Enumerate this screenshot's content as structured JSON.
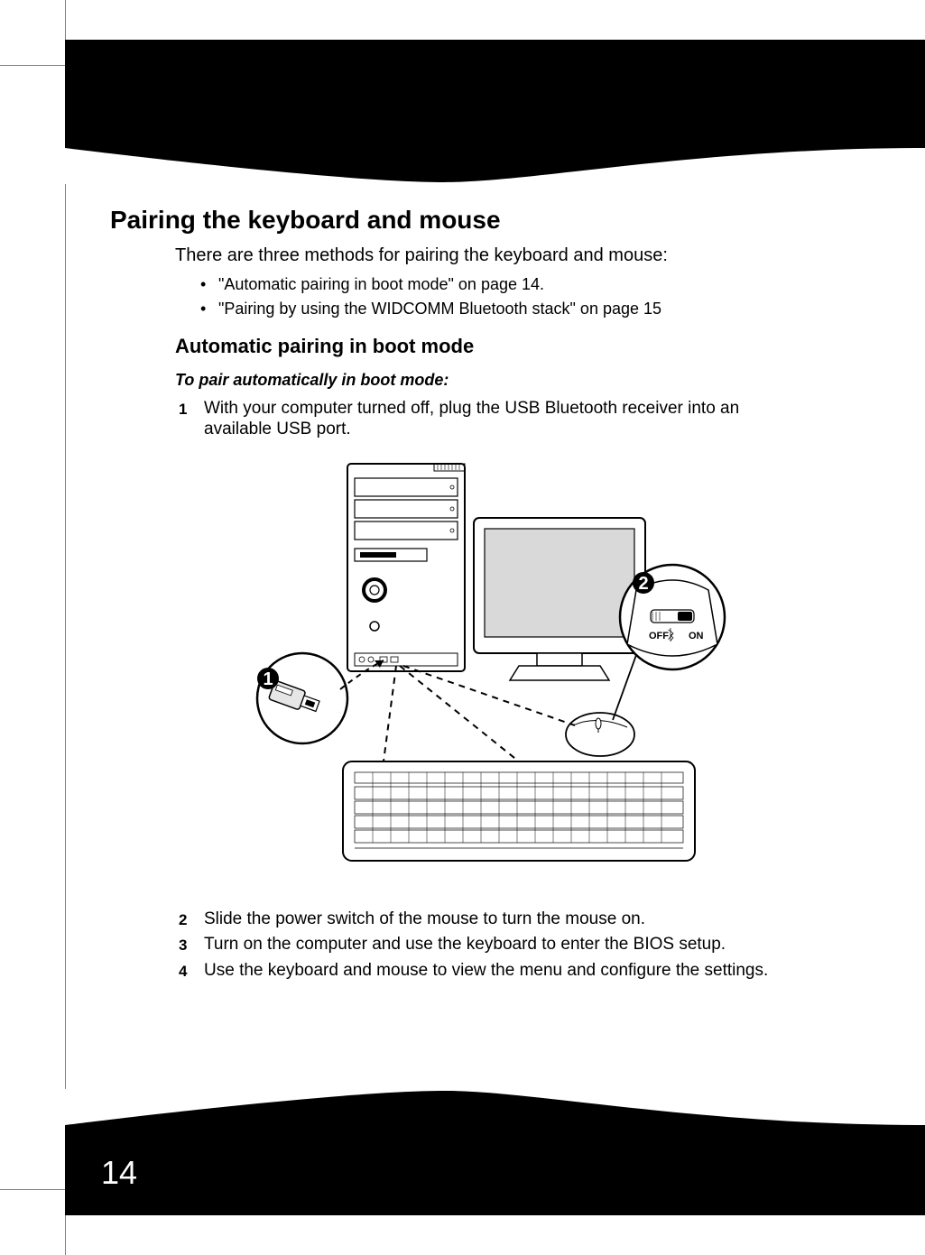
{
  "page": {
    "number": "14"
  },
  "heading": "Pairing the keyboard and mouse",
  "intro": "There are three methods for pairing the keyboard and mouse:",
  "bullets": [
    "\"Automatic pairing in boot mode\" on page 14.",
    "\"Pairing by using the WIDCOMM Bluetooth stack\" on page 15"
  ],
  "subheading": "Automatic pairing in boot mode",
  "procedure_title": "To pair automatically in boot mode:",
  "steps": [
    "With your computer turned off, plug the USB Bluetooth receiver into an available USB port.",
    "Slide the power switch of the mouse to turn the mouse on.",
    "Turn on the computer and use the keyboard to enter the BIOS setup.",
    "Use the keyboard and mouse to view the menu and configure the settings."
  ],
  "illustration": {
    "callout1": "1",
    "callout2": "2",
    "label_off": "OFF",
    "label_on": "ON"
  }
}
